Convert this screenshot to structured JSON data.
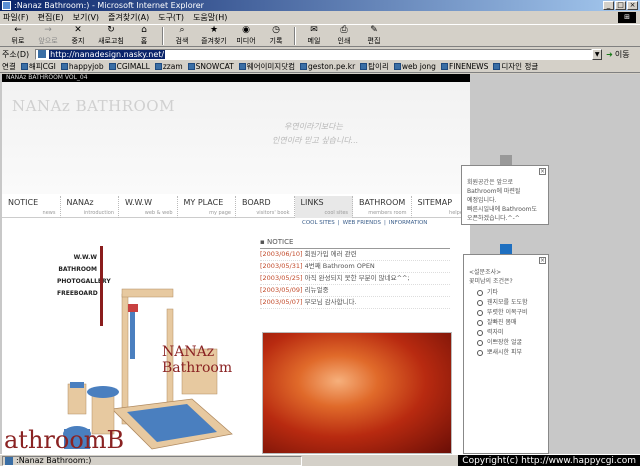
{
  "window": {
    "title": ":Nanaz Bathroom:) - Microsoft Internet Explorer",
    "minimize": "_",
    "maximize": "□",
    "close": "×"
  },
  "menu": [
    "파일(F)",
    "편집(E)",
    "보기(V)",
    "즐겨찾기(A)",
    "도구(T)",
    "도움말(H)"
  ],
  "toolbar": [
    {
      "label": "뒤로",
      "icon": "back-arrow-icon",
      "glyph": "←"
    },
    {
      "label": "앞으로",
      "icon": "forward-arrow-icon",
      "glyph": "→"
    },
    {
      "label": "중지",
      "icon": "stop-icon",
      "glyph": "✕"
    },
    {
      "label": "새로고침",
      "icon": "refresh-icon",
      "glyph": "↻"
    },
    {
      "label": "홈",
      "icon": "home-icon",
      "glyph": "⌂"
    },
    {
      "label": "검색",
      "icon": "search-icon",
      "glyph": "⌕"
    },
    {
      "label": "즐겨찾기",
      "icon": "favorites-icon",
      "glyph": "★"
    },
    {
      "label": "미디어",
      "icon": "media-icon",
      "glyph": "◉"
    },
    {
      "label": "기록",
      "icon": "history-icon",
      "glyph": "◷"
    },
    {
      "label": "메일",
      "icon": "mail-icon",
      "glyph": "✉"
    },
    {
      "label": "인쇄",
      "icon": "print-icon",
      "glyph": "⎙"
    },
    {
      "label": "편집",
      "icon": "edit-icon",
      "glyph": "✎"
    }
  ],
  "address": {
    "label": "주소(D)",
    "url": "http://nanadesign.nasky.net/",
    "go": "이동"
  },
  "links": {
    "label": "연결",
    "items": [
      "해피CGI",
      "happyjob",
      "CGIMALL",
      "zzam",
      "SNOWCAT",
      "웨어이미지닷컴",
      "geston.pe.kr",
      "탑이리",
      "web jong",
      "FINENEWS",
      "디자인 정글"
    ]
  },
  "page": {
    "topbar": "NANAz BATHROOM VOL_04",
    "brand": "NANAz BATHROOM",
    "slogan": [
      "우연이라기보다는",
      "인연이라 믿고 싶습니다..."
    ],
    "nav": [
      {
        "title": "NOTICE",
        "sub": "news"
      },
      {
        "title": "NANAz",
        "sub": "introduction"
      },
      {
        "title": "W.W.W",
        "sub": "web & web"
      },
      {
        "title": "MY PLACE",
        "sub": "my page"
      },
      {
        "title": "BOARD",
        "sub": "visitors' book"
      },
      {
        "title": "LINKS",
        "sub": "cool sites"
      },
      {
        "title": "BATHROOM",
        "sub": "members room"
      },
      {
        "title": "SITEMAP",
        "sub": "helper"
      }
    ],
    "subnav": [
      "COOL SITES",
      "|",
      "WEB FRIENDS",
      "|",
      "INFORMATION"
    ],
    "leftmenu": [
      "W.W.W",
      "BATHROOM",
      "PHOTOGALLERY",
      "FREEBOARD"
    ],
    "nanaz_text": [
      "NANAz",
      "Bathroom"
    ],
    "bottom_text": "athroomB",
    "notice": {
      "header": "NOTICE",
      "rows": [
        {
          "date": "[2003/06/10]",
          "text": "회원가입 에러 관련"
        },
        {
          "date": "[2003/05/31]",
          "text": "4번째 Bathroom OPEN"
        },
        {
          "date": "[2003/05/25]",
          "text": "아직 완성되지 못한 부분이 많네요^^;"
        },
        {
          "date": "[2003/05/09]",
          "text": "리뉴얼중"
        },
        {
          "date": "[2003/05/07]",
          "text": "부모님 감사합니다."
        }
      ]
    }
  },
  "popup1": {
    "lines": [
      "회원공간은 앞으로",
      "Bathroom에 마련될",
      "예정입니다.",
      "빠른시일내에 Bathroom도",
      "오픈하겠습니다.^-^"
    ]
  },
  "popup2": {
    "title": "<설문조사>",
    "question": "꽃미남의 조건은?",
    "options": [
      "기타",
      "웬지모를 도도함",
      "뚜렷한 이목구비",
      "잘빠진 몸매",
      "력자미",
      "이쁘장한 얼굴",
      "뽀새시한 피부"
    ]
  },
  "status": {
    "text": ":Nanaz Bathroom:)",
    "copyright": "Copyright(c) http://www.happycgi.com"
  }
}
